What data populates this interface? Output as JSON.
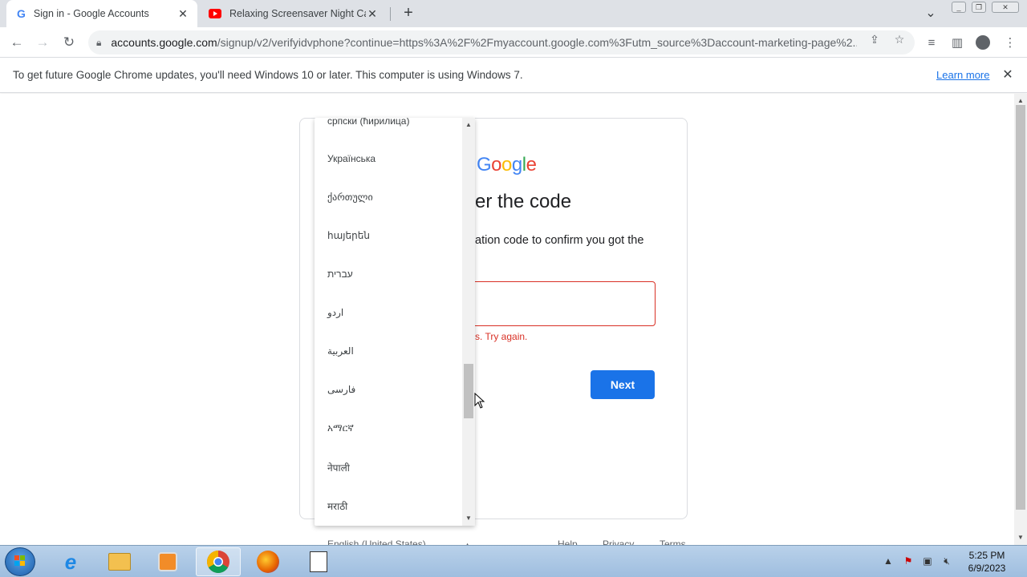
{
  "browser": {
    "tabs": [
      {
        "title": "Sign in - Google Accounts",
        "icon": "google-g-icon",
        "active": true
      },
      {
        "title": "Relaxing Screensaver Night Car S",
        "icon": "youtube-icon",
        "active": false
      }
    ],
    "url_host": "accounts.google.com",
    "url_rest": "/signup/v2/verifyidvphone?continue=https%3A%2F%2Fmyaccount.google.com%3Futm_source%3Daccount-marketing-page%2..."
  },
  "infobar": {
    "message": "To get future Google Chrome updates, you'll need Windows 10 or later. This computer is using Windows 7.",
    "learn_more": "Learn more"
  },
  "card": {
    "logo": "Google",
    "heading_visible": "er the code",
    "description_visible": "ation code to confirm you got the",
    "error_visible": "s. Try again.",
    "next_button": "Next"
  },
  "footer": {
    "language": "English (United States)",
    "help": "Help",
    "privacy": "Privacy",
    "terms": "Terms"
  },
  "language_dropdown": {
    "items": [
      "српски (ћирилица)",
      "Українська",
      "ქართული",
      "հայերեն",
      "עברית",
      "اردو",
      "العربية",
      "فارسی",
      "አማርኛ",
      "नेपाली",
      "मराठी"
    ]
  },
  "taskbar": {
    "time": "5:25 PM",
    "date": "6/9/2023"
  },
  "colors": {
    "accent": "#1a73e8",
    "error": "#d93025"
  }
}
